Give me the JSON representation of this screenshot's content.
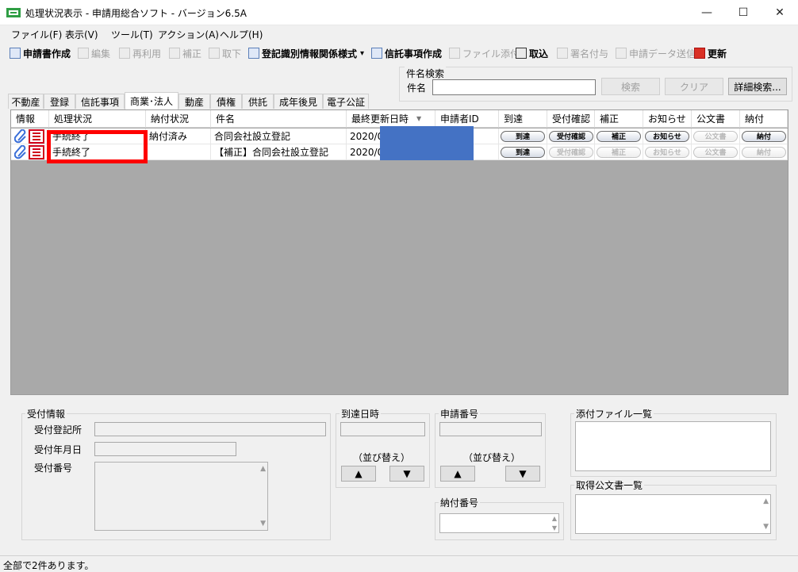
{
  "window": {
    "title": "処理状況表示 - 申請用総合ソフト - バージョン6.5A",
    "minimize": "—",
    "maximize": "☐",
    "close": "✕"
  },
  "menu": [
    "ファイル(F)",
    "表示(V)",
    "ツール(T)",
    "アクション(A)",
    "ヘルプ(H)"
  ],
  "toolbar": {
    "create": "申請書作成",
    "edit": "編集",
    "reuse": "再利用",
    "correct": "補正",
    "withdraw": "取下",
    "reg_format": "登記識別情報関係様式",
    "reg_format_arrow": "▾",
    "trust_create": "信託事項作成",
    "attach": "ファイル添付",
    "import": "取込",
    "sign": "署名付与",
    "send": "申請データ送信",
    "refresh": "更新"
  },
  "search": {
    "group_label": "件名検索",
    "field_label": "件名",
    "value": "",
    "search_button": "検索",
    "clear_button": "クリア",
    "detail_button": "詳細検索..."
  },
  "tabs": [
    "不動産",
    "登録",
    "信託事項",
    "商業･法人",
    "動産",
    "債権",
    "供託",
    "成年後見",
    "電子公証"
  ],
  "active_tab": "商業･法人",
  "grid": {
    "sort_indicator": "▼",
    "columns": [
      "情報",
      "処理状況",
      "納付状況",
      "件名",
      "最終更新日時",
      "申請者ID",
      "到達",
      "受付確認",
      "補正",
      "お知らせ",
      "公文書",
      "納付"
    ],
    "rows": [
      {
        "status": "手続終了",
        "payment": "納付済み",
        "subject": "合同会社設立登記",
        "updated": "2020/08",
        "applicant": "",
        "buttons": [
          "到達",
          "受付確認",
          "補正",
          "お知らせ",
          "公文書",
          "納付"
        ],
        "enabled": [
          true,
          true,
          true,
          true,
          false,
          true
        ]
      },
      {
        "status": "手続終了",
        "payment": "",
        "subject": "【補正】合同会社設立登記",
        "updated": "2020/08",
        "applicant": "",
        "buttons": [
          "到達",
          "受付確認",
          "補正",
          "お知らせ",
          "公文書",
          "納付"
        ],
        "enabled": [
          true,
          false,
          false,
          false,
          false,
          false
        ]
      }
    ]
  },
  "detail": {
    "receipt_group": "受付情報",
    "receipt_office": "受付登記所",
    "receipt_date": "受付年月日",
    "receipt_number": "受付番号",
    "arrival_group": "到達日時",
    "application_group": "申請番号",
    "sort_label": "（並び替え）",
    "up": "▲",
    "down": "▼",
    "payment_group": "納付番号",
    "attachments_group": "添付ファイル一覧",
    "documents_group": "取得公文書一覧"
  },
  "status_bar": "全部で2件あります。",
  "colors": {
    "highlight": "#ff0000",
    "redaction": "#4472c4",
    "grid_bg": "#a9a9a9"
  }
}
